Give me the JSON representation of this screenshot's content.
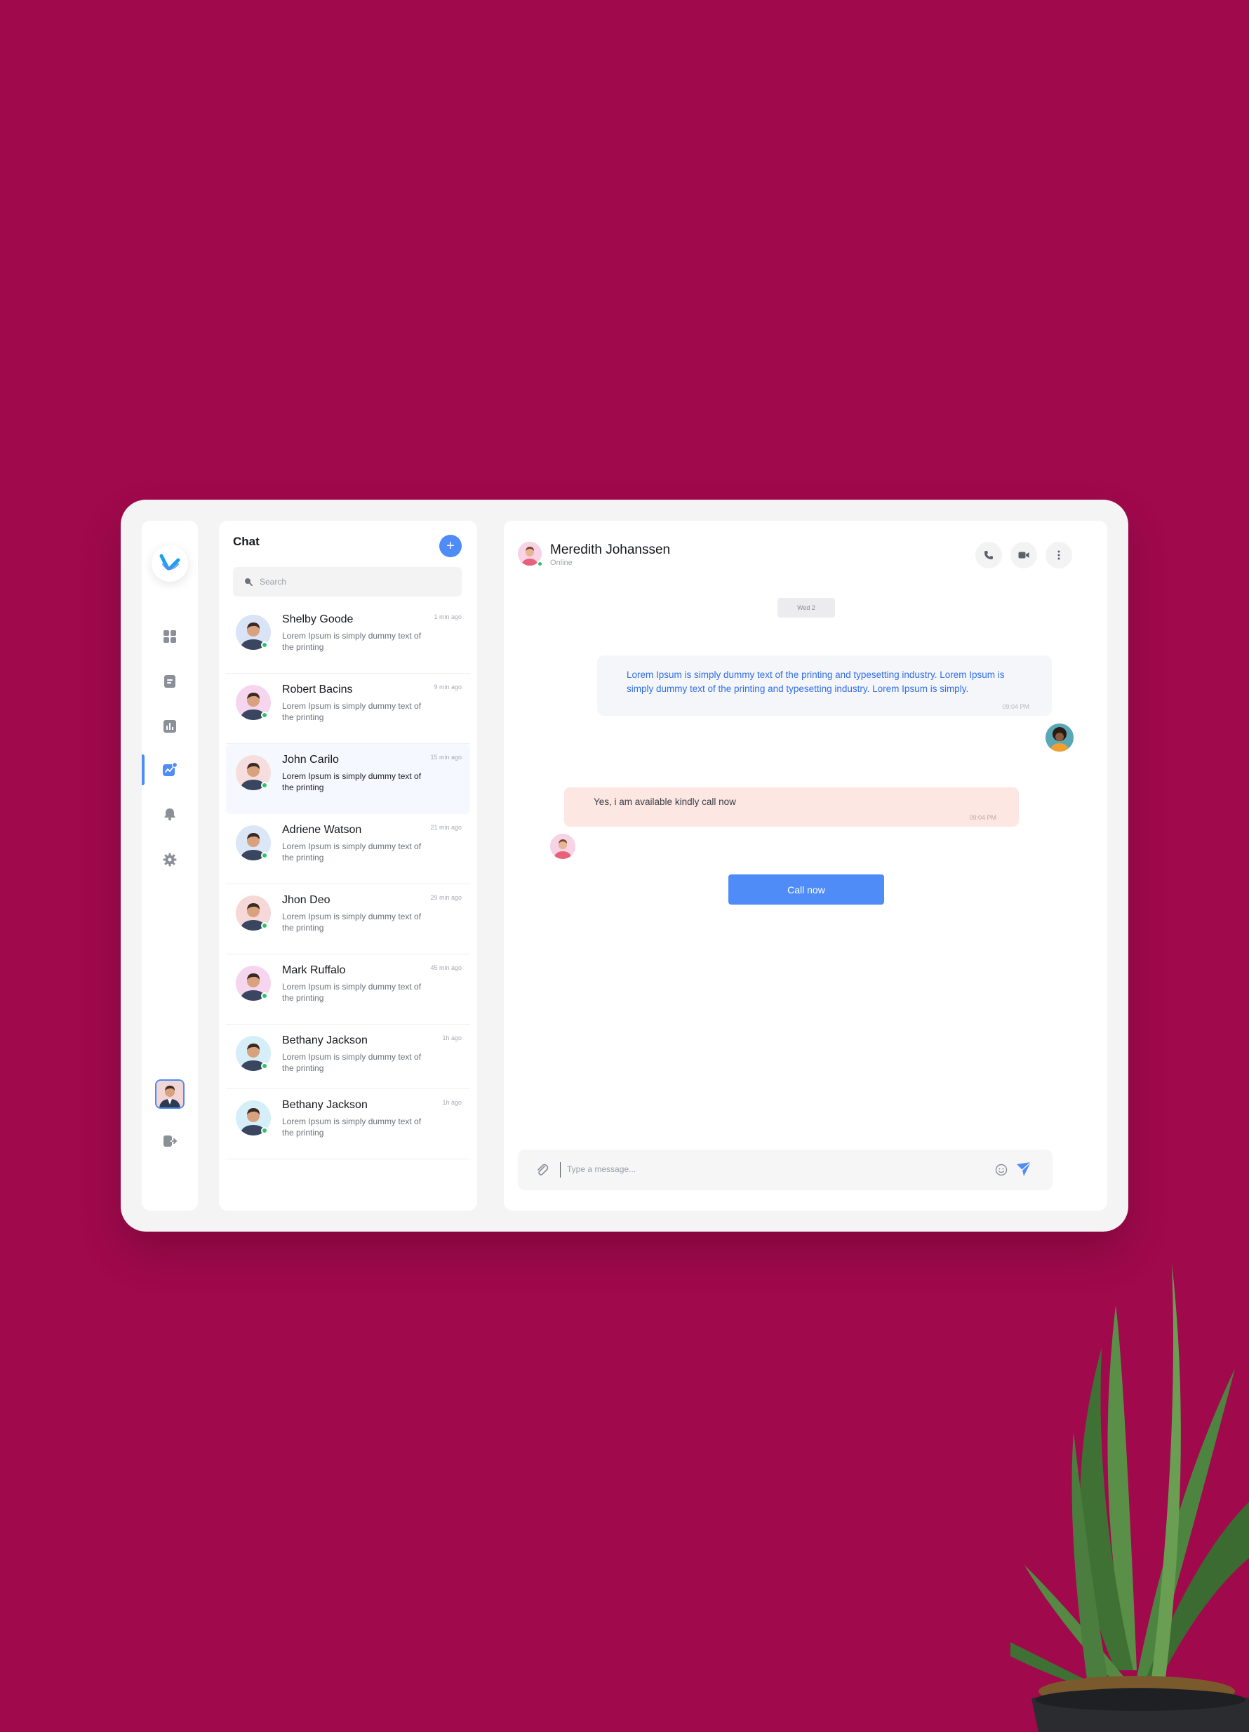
{
  "sidebar": {
    "logo_icon": "brand-logo-icon",
    "items": [
      {
        "icon": "grid-icon",
        "active": false
      },
      {
        "icon": "document-icon",
        "active": false
      },
      {
        "icon": "bar-chart-icon",
        "active": false
      },
      {
        "icon": "chat-trend-icon",
        "active": true
      },
      {
        "icon": "bell-icon",
        "active": false
      },
      {
        "icon": "gear-icon",
        "active": false
      }
    ],
    "logout_icon": "logout-icon"
  },
  "chat_list": {
    "title": "Chat",
    "add_icon": "+",
    "search_placeholder": "Search",
    "items": [
      {
        "name": "Shelby Goode",
        "preview": "Lorem Ipsum is simply dummy text of the printing",
        "time": "1 min ago",
        "online": true,
        "avatar_bg": "#d9e4f7"
      },
      {
        "name": "Robert Bacins",
        "preview": "Lorem Ipsum is simply dummy text of the printing",
        "time": "9 min ago",
        "online": true,
        "avatar_bg": "#f6d6ef"
      },
      {
        "name": "John Carilo",
        "preview": "Lorem Ipsum is simply dummy text of the printing",
        "time": "15 min ago",
        "online": true,
        "avatar_bg": "#f7dede"
      },
      {
        "name": "Adriene Watson",
        "preview": "Lorem Ipsum is simply dummy text of the printing",
        "time": "21 min ago",
        "online": true,
        "avatar_bg": "#dbe6f7"
      },
      {
        "name": "Jhon Deo",
        "preview": "Lorem Ipsum is simply dummy text of the printing",
        "time": "29 min ago",
        "online": true,
        "avatar_bg": "#f6d8d8"
      },
      {
        "name": "Mark Ruffalo",
        "preview": "Lorem Ipsum is simply dummy text of the printing",
        "time": "45 min ago",
        "online": true,
        "avatar_bg": "#f6d6ef"
      },
      {
        "name": "Bethany Jackson",
        "preview": "Lorem Ipsum is simply dummy text of the printing",
        "time": "1h ago",
        "online": true,
        "avatar_bg": "#d6eef7"
      },
      {
        "name": "Bethany Jackson",
        "preview": "Lorem Ipsum is simply dummy text of the printing",
        "time": "1h ago",
        "online": true,
        "avatar_bg": "#d6eef7"
      }
    ]
  },
  "conversation": {
    "contact_name": "Meredith Johanssen",
    "contact_status": "Online",
    "actions": [
      "phone-icon",
      "video-icon",
      "more-vertical-icon"
    ],
    "date_chip": "Wed 2",
    "messages": [
      {
        "direction": "outgoing",
        "text": "Lorem Ipsum is simply dummy text of the printing and typesetting industry.  Lorem Ipsum is simply dummy text of the printing and typesetting industry. Lorem Ipsum is simply.",
        "time": "09:04 PM"
      },
      {
        "direction": "incoming",
        "text": "Yes, i am available kindly call now",
        "time": "09:04 PM"
      }
    ],
    "call_button": "Call now",
    "composer_placeholder": "Type a message..."
  },
  "colors": {
    "background": "#a0094c",
    "accent": "#4f8cf7",
    "online": "#2bc46b",
    "incoming_bubble": "#fce7e2",
    "outgoing_text": "#2f6fe8"
  }
}
